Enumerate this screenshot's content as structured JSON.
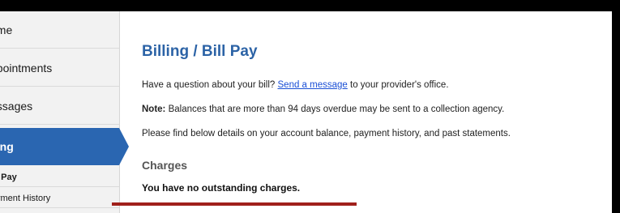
{
  "sidebar": {
    "items": [
      {
        "label": "ome"
      },
      {
        "label": "ppointments"
      },
      {
        "label": "essages"
      },
      {
        "label": "lling"
      }
    ],
    "subitems": [
      {
        "label": "l Pay"
      },
      {
        "label": "yment History"
      }
    ],
    "active_color": "#2a66b1"
  },
  "main": {
    "title": "Billing / Bill Pay",
    "question_prefix": "Have a question about your bill? ",
    "question_link": "Send a message",
    "question_suffix": " to your provider's office.",
    "note_label": "Note:",
    "note_text": " Balances that are more than 94 days overdue may be sent to a collection agency.",
    "details_text": "Please find below details on your account balance, payment history, and past statements.",
    "charges_heading": "Charges",
    "no_charges_text": "You have no outstanding charges."
  },
  "colors": {
    "title": "#2c63a6",
    "link": "#1a4fd6",
    "accent_bar": "#a0201b"
  }
}
